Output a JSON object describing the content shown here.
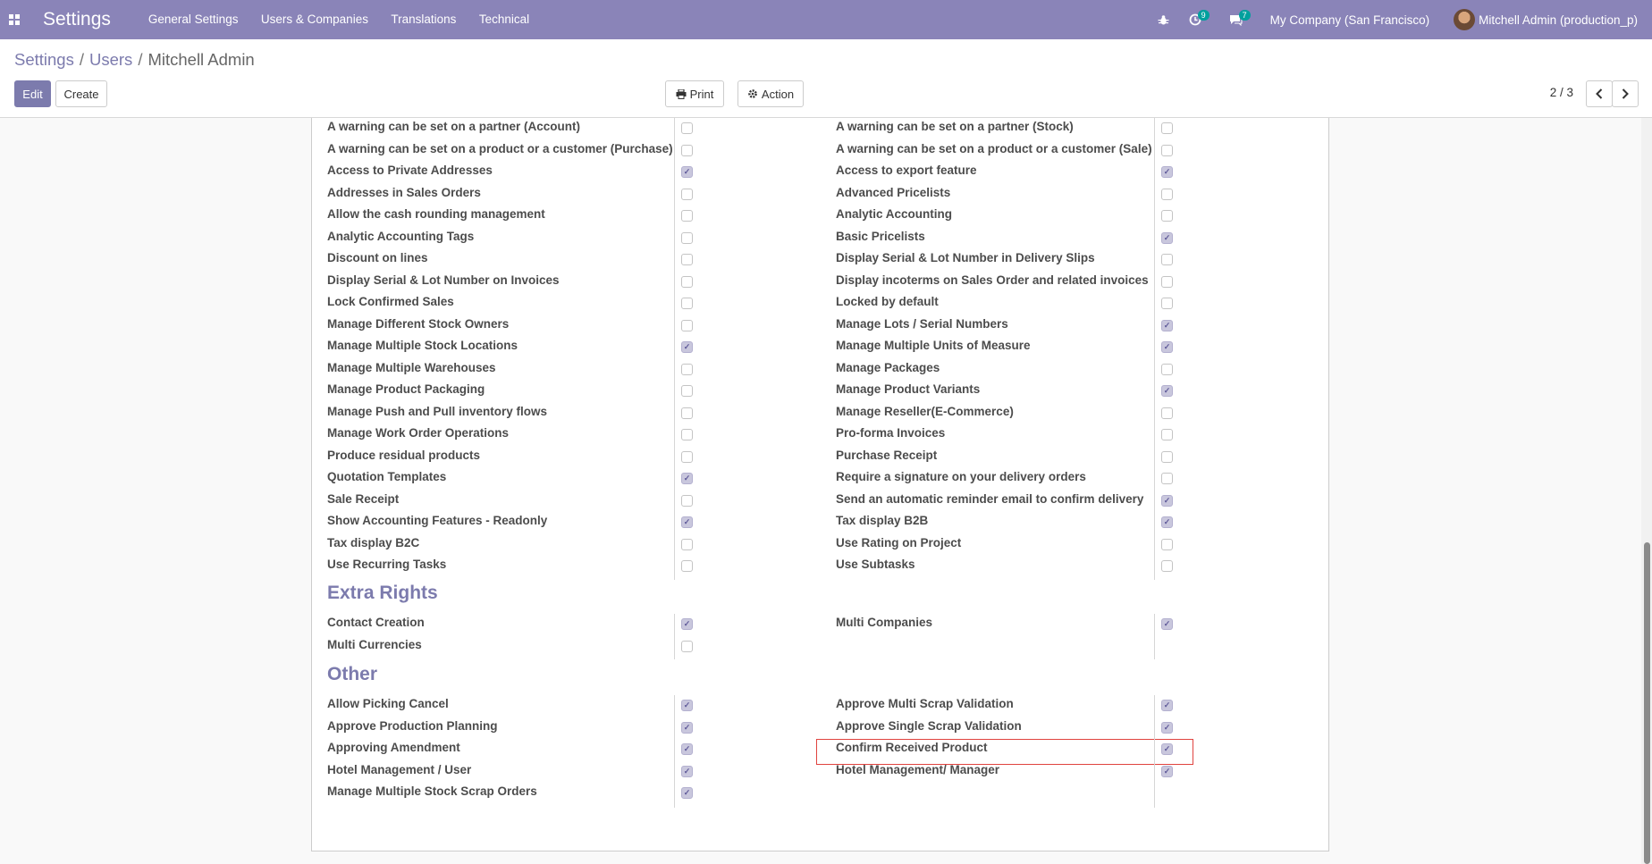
{
  "navbar": {
    "app_title": "Settings",
    "menu": [
      "General Settings",
      "Users & Companies",
      "Translations",
      "Technical"
    ],
    "activity_count": "9",
    "message_count": "7",
    "company": "My Company (San Francisco)",
    "user": "Mitchell Admin (production_p)",
    "colors": {
      "navbar": "#8a84b8",
      "badge": "#00a09d"
    }
  },
  "breadcrumb": [
    "Settings",
    "Users",
    "Mitchell Admin"
  ],
  "buttons": {
    "edit": "Edit",
    "create": "Create",
    "print": "Print",
    "action": "Action"
  },
  "pager": "2 / 3",
  "technical_rows_left": [
    {
      "label": "A warning can be set on a partner (Account)",
      "checked": false
    },
    {
      "label": "A warning can be set on a product or a customer (Purchase)",
      "checked": false
    },
    {
      "label": "Access to Private Addresses",
      "checked": true
    },
    {
      "label": "Addresses in Sales Orders",
      "checked": false
    },
    {
      "label": "Allow the cash rounding management",
      "checked": false
    },
    {
      "label": "Analytic Accounting Tags",
      "checked": false
    },
    {
      "label": "Discount on lines",
      "checked": false
    },
    {
      "label": "Display Serial & Lot Number on Invoices",
      "checked": false
    },
    {
      "label": "Lock Confirmed Sales",
      "checked": false
    },
    {
      "label": "Manage Different Stock Owners",
      "checked": false
    },
    {
      "label": "Manage Multiple Stock Locations",
      "checked": true
    },
    {
      "label": "Manage Multiple Warehouses",
      "checked": false
    },
    {
      "label": "Manage Product Packaging",
      "checked": false
    },
    {
      "label": "Manage Push and Pull inventory flows",
      "checked": false
    },
    {
      "label": "Manage Work Order Operations",
      "checked": false
    },
    {
      "label": "Produce residual products",
      "checked": false
    },
    {
      "label": "Quotation Templates",
      "checked": true
    },
    {
      "label": "Sale Receipt",
      "checked": false
    },
    {
      "label": "Show Accounting Features - Readonly",
      "checked": true
    },
    {
      "label": "Tax display B2C",
      "checked": false
    },
    {
      "label": "Use Recurring Tasks",
      "checked": false
    }
  ],
  "technical_rows_right": [
    {
      "label": "A warning can be set on a partner (Stock)",
      "checked": false
    },
    {
      "label": "A warning can be set on a product or a customer (Sale)",
      "checked": false
    },
    {
      "label": "Access to export feature",
      "checked": true
    },
    {
      "label": "Advanced Pricelists",
      "checked": false
    },
    {
      "label": "Analytic Accounting",
      "checked": false
    },
    {
      "label": "Basic Pricelists",
      "checked": true
    },
    {
      "label": "Display Serial & Lot Number in Delivery Slips",
      "checked": false
    },
    {
      "label": "Display incoterms on Sales Order and related invoices",
      "checked": false
    },
    {
      "label": "Locked by default",
      "checked": false
    },
    {
      "label": "Manage Lots / Serial Numbers",
      "checked": true
    },
    {
      "label": "Manage Multiple Units of Measure",
      "checked": true
    },
    {
      "label": "Manage Packages",
      "checked": false
    },
    {
      "label": "Manage Product Variants",
      "checked": true
    },
    {
      "label": "Manage Reseller(E-Commerce)",
      "checked": false
    },
    {
      "label": "Pro-forma Invoices",
      "checked": false
    },
    {
      "label": "Purchase Receipt",
      "checked": false
    },
    {
      "label": "Require a signature on your delivery orders",
      "checked": false
    },
    {
      "label": "Send an automatic reminder email to confirm delivery",
      "checked": true
    },
    {
      "label": "Tax display B2B",
      "checked": true
    },
    {
      "label": "Use Rating on Project",
      "checked": false
    },
    {
      "label": "Use Subtasks",
      "checked": false
    }
  ],
  "extra_rights": {
    "title": "Extra Rights",
    "left": [
      {
        "label": "Contact Creation",
        "checked": true
      },
      {
        "label": "Multi Currencies",
        "checked": false
      }
    ],
    "right": [
      {
        "label": "Multi Companies",
        "checked": true
      }
    ]
  },
  "other": {
    "title": "Other",
    "left": [
      {
        "label": "Allow Picking Cancel",
        "checked": true
      },
      {
        "label": "Approve Production Planning",
        "checked": true
      },
      {
        "label": "Approving Amendment",
        "checked": true
      },
      {
        "label": "Hotel Management / User",
        "checked": true
      },
      {
        "label": "Manage Multiple Stock Scrap Orders",
        "checked": true
      }
    ],
    "right": [
      {
        "label": "Approve Multi Scrap Validation",
        "checked": true
      },
      {
        "label": "Approve Single Scrap Validation",
        "checked": true
      },
      {
        "label": "Confirm Received Product",
        "checked": true
      },
      {
        "label": "Hotel Management/ Manager",
        "checked": true
      }
    ]
  }
}
